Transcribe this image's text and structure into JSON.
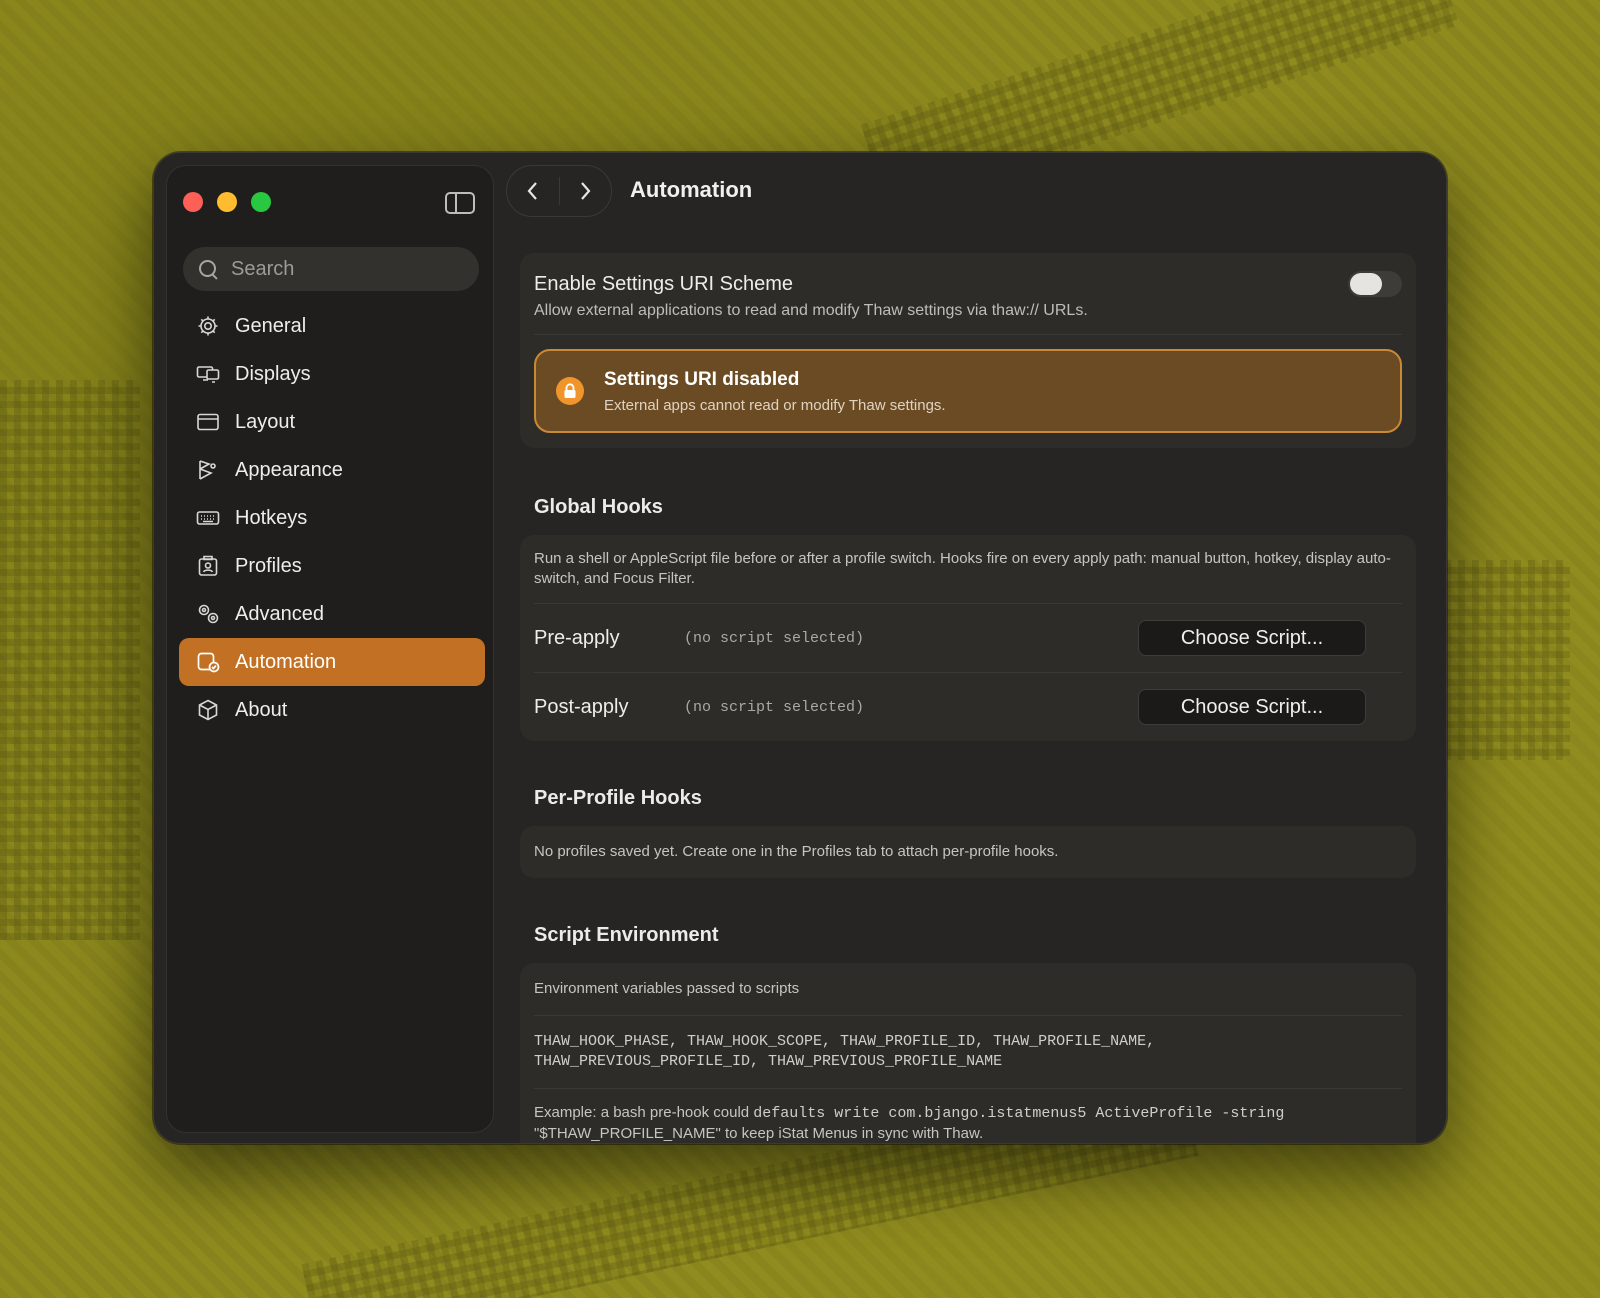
{
  "window": {
    "page_title": "Automation"
  },
  "sidebar": {
    "search_placeholder": "Search",
    "items": [
      {
        "label": "General",
        "icon": "gear-icon"
      },
      {
        "label": "Displays",
        "icon": "displays-icon"
      },
      {
        "label": "Layout",
        "icon": "layout-icon"
      },
      {
        "label": "Appearance",
        "icon": "appearance-icon"
      },
      {
        "label": "Hotkeys",
        "icon": "keyboard-icon"
      },
      {
        "label": "Profiles",
        "icon": "profiles-icon"
      },
      {
        "label": "Advanced",
        "icon": "advanced-gears-icon"
      },
      {
        "label": "Automation",
        "icon": "automation-icon",
        "active": true
      },
      {
        "label": "About",
        "icon": "cube-icon"
      }
    ],
    "accent_color": "#c27124"
  },
  "uri_scheme": {
    "title": "Enable Settings URI Scheme",
    "subtitle": "Allow external applications to read and modify Thaw settings via thaw:// URLs.",
    "enabled": false,
    "banner_title": "Settings URI disabled",
    "banner_subtitle": "External apps cannot read or modify Thaw settings."
  },
  "global_hooks": {
    "heading": "Global Hooks",
    "description": "Run a shell or AppleScript file before or after a profile switch. Hooks fire on every apply path: manual button, hotkey, display auto-switch, and Focus Filter.",
    "rows": [
      {
        "label": "Pre-apply",
        "value": "(no script selected)",
        "button": "Choose Script..."
      },
      {
        "label": "Post-apply",
        "value": "(no script selected)",
        "button": "Choose Script..."
      }
    ]
  },
  "per_profile": {
    "heading": "Per-Profile Hooks",
    "description": "No profiles saved yet. Create one in the Profiles tab to attach per-profile hooks."
  },
  "script_env": {
    "heading": "Script Environment",
    "label": "Environment variables passed to scripts",
    "vars_line1": "THAW_HOOK_PHASE, THAW_HOOK_SCOPE, THAW_PROFILE_ID, THAW_PROFILE_NAME,",
    "vars_line2": "THAW_PREVIOUS_PROFILE_ID, THAW_PREVIOUS_PROFILE_NAME",
    "example_prefix": "Example: a bash pre-hook could ",
    "example_code": "defaults write com.bjango.istatmenus5 ActiveProfile -string",
    "example_line2": "\"$THAW_PROFILE_NAME\" to keep iStat Menus in sync with Thaw."
  }
}
